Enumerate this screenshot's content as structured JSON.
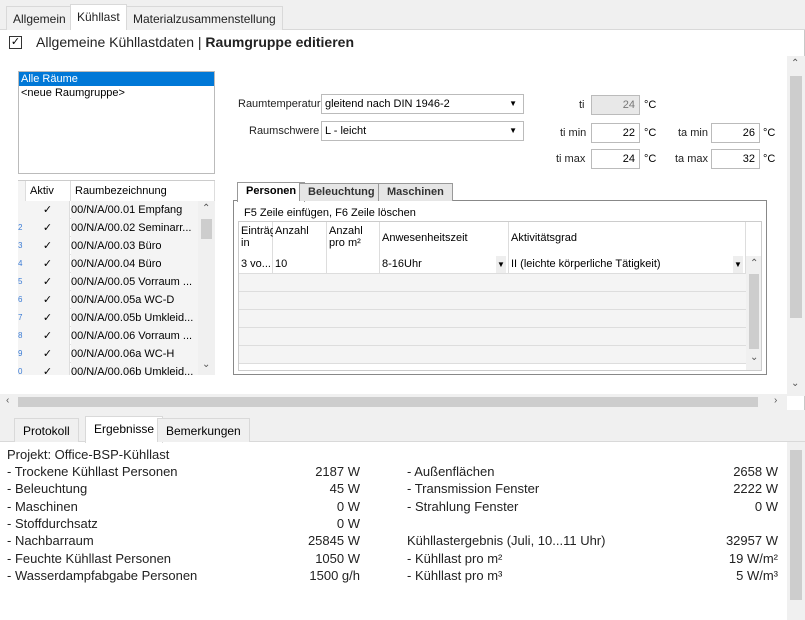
{
  "tabs": [
    "Allgemein",
    "Kühllast",
    "Materialzusammenstellung"
  ],
  "header": {
    "checkbox_checked": true,
    "title_prefix": "Allgemeine Kühllastdaten",
    "separator": "|",
    "title": "Raumgruppe editieren"
  },
  "raumgruppen": [
    "Alle Räume",
    "<neue Raumgruppe>"
  ],
  "raum_table": {
    "headers": [
      "Aktiv",
      "Raumbezeichnung"
    ],
    "rows": [
      {
        "mark": "",
        "aktiv": "✓",
        "name": "00/N/A/00.01 Empfang"
      },
      {
        "mark": "2",
        "aktiv": "✓",
        "name": "00/N/A/00.02 Seminarr..."
      },
      {
        "mark": "3",
        "aktiv": "✓",
        "name": "00/N/A/00.03 Büro"
      },
      {
        "mark": "4",
        "aktiv": "✓",
        "name": "00/N/A/00.04 Büro"
      },
      {
        "mark": "5",
        "aktiv": "✓",
        "name": "00/N/A/00.05 Vorraum ..."
      },
      {
        "mark": "6",
        "aktiv": "✓",
        "name": "00/N/A/00.05a WC-D"
      },
      {
        "mark": "7",
        "aktiv": "✓",
        "name": "00/N/A/00.05b Umkleid..."
      },
      {
        "mark": "8",
        "aktiv": "✓",
        "name": "00/N/A/00.06 Vorraum ..."
      },
      {
        "mark": "9",
        "aktiv": "✓",
        "name": "00/N/A/00.06a WC-H"
      },
      {
        "mark": "0",
        "aktiv": "✓",
        "name": "00/N/A/00.06b Umkleid..."
      }
    ]
  },
  "form": {
    "raumtemperatur_label": "Raumtemperatur",
    "raumtemperatur_value": "gleitend nach DIN 1946-2",
    "raumschwere_label": "Raumschwere",
    "raumschwere_value": "L - leicht",
    "ti_label": "ti",
    "ti_value": "24",
    "ti_min_label": "ti min",
    "ti_min_value": "22",
    "ti_max_label": "ti max",
    "ti_max_value": "24",
    "ta_min_label": "ta min",
    "ta_min_value": "26",
    "ta_max_label": "ta max",
    "ta_max_value": "32",
    "unit": "°C"
  },
  "inner_tabs": [
    "Personen",
    "Beleuchtung",
    "Maschinen"
  ],
  "personen": {
    "hint": "F5 Zeile einfügen, F6 Zeile löschen",
    "headers": [
      "Einträg in",
      "Anzahl",
      "Anzahl pro m²",
      "Anwesenheitszeit",
      "Aktivitätsgrad"
    ],
    "row": {
      "eintrag": "3 vo...",
      "anzahl": "10",
      "anzahl_pro_m2": "",
      "anwesenheit": "8-16Uhr",
      "aktivitaet": "II (leichte körperliche Tätigkeit)"
    }
  },
  "bottom_tabs": [
    "Protokoll",
    "Ergebnisse",
    "Bemerkungen"
  ],
  "results": {
    "projekt": "Projekt: Office-BSP-Kühllast",
    "left": [
      {
        "label": "- Trockene Kühllast Personen",
        "value": "2187 W"
      },
      {
        "label": "- Beleuchtung",
        "value": "45 W"
      },
      {
        "label": "- Maschinen",
        "value": "0 W"
      },
      {
        "label": "- Stoffdurchsatz",
        "value": "0 W"
      },
      {
        "label": "- Nachbarraum",
        "value": "25845 W"
      },
      {
        "label": "- Feuchte Kühllast Personen",
        "value": "1050 W"
      },
      {
        "label": "- Wasserdampfabgabe Personen",
        "value": "1500 g/h"
      }
    ],
    "right": [
      {
        "label": "- Außenflächen",
        "value": "2658 W"
      },
      {
        "label": "- Transmission Fenster",
        "value": "2222 W"
      },
      {
        "label": "- Strahlung Fenster",
        "value": "0 W"
      },
      {
        "label": "",
        "value": ""
      },
      {
        "label": "Kühllastergebnis (Juli, 10...11 Uhr)",
        "value": "32957 W"
      },
      {
        "label": "- Kühllast pro m²",
        "value": "19 W/m²"
      },
      {
        "label": "- Kühllast pro m³",
        "value": "5 W/m³"
      }
    ]
  }
}
